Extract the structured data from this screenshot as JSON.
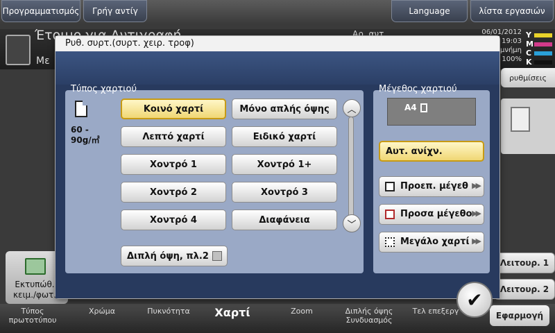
{
  "top_bar": {
    "programs": "Προγραμματισμός",
    "quick_id": "Γρήγ αντίγ",
    "language": "Language",
    "job_list": "λίστα εργασιών"
  },
  "background": {
    "title": "Έτοιμο για Αντιγραφή",
    "sub": "Με",
    "counter": "Αρ. αντ.",
    "date": "06/01/2012",
    "time": "19:03",
    "memory_label": "μνήμη",
    "memory_value": "100%",
    "toner": [
      {
        "letter": "Y",
        "color": "#e8d22a"
      },
      {
        "letter": "M",
        "color": "#d23a8a"
      },
      {
        "letter": "C",
        "color": "#2aa0d8"
      },
      {
        "letter": "K",
        "color": "#111111"
      }
    ],
    "settings_btn": "ρυθμίσεις",
    "func1": "Λειτουρ. 1",
    "func2": "Λειτουρ. 2",
    "left_icon_label": "Εκτυπώθ. κειμ./φωτ.",
    "tabs": [
      {
        "label": "Τύπος πρωτοτύπου"
      },
      {
        "label": "Χρώμα"
      },
      {
        "label": "Πυκνότητα"
      },
      {
        "label": "Χαρτί"
      },
      {
        "label": "Zoom"
      },
      {
        "label": "Διπλής όψης Συνδυασμός"
      },
      {
        "label": "Τελ επεξεργ"
      }
    ],
    "apply": "Εφαρμογή"
  },
  "dialog": {
    "title": "Ρυθ. συρτ.(συρτ. χειρ. τροφ)",
    "paper_type_label": "Τύπος χαρτιού",
    "weight": [
      "60 -",
      "90g/㎡"
    ],
    "types": [
      {
        "label": "Κοινό χαρτί",
        "selected": true
      },
      {
        "label": "Μόνο απλής όψης",
        "selected": false
      },
      {
        "label": "Λεπτό χαρτί",
        "selected": false
      },
      {
        "label": "Ειδικό χαρτί",
        "selected": false
      },
      {
        "label": "Χοντρό 1",
        "selected": false
      },
      {
        "label": "Χοντρό 1+",
        "selected": false
      },
      {
        "label": "Χοντρό 2",
        "selected": false
      },
      {
        "label": "Χοντρό 3",
        "selected": false
      },
      {
        "label": "Χοντρό 4",
        "selected": false
      },
      {
        "label": "Διαφάνεια",
        "selected": false
      }
    ],
    "duplex_label": "Διπλή όψη, πλ.2",
    "paper_size_label": "Μέγεθος χαρτιού",
    "current_size": "A4",
    "auto_detect": "Αυτ. ανίχν.",
    "standard_size": "Προεπ. μέγεθ",
    "custom_size": "Προσα μέγεθο",
    "large_paper": "Μεγάλο χαρτί",
    "ok_symbol": "✔"
  }
}
